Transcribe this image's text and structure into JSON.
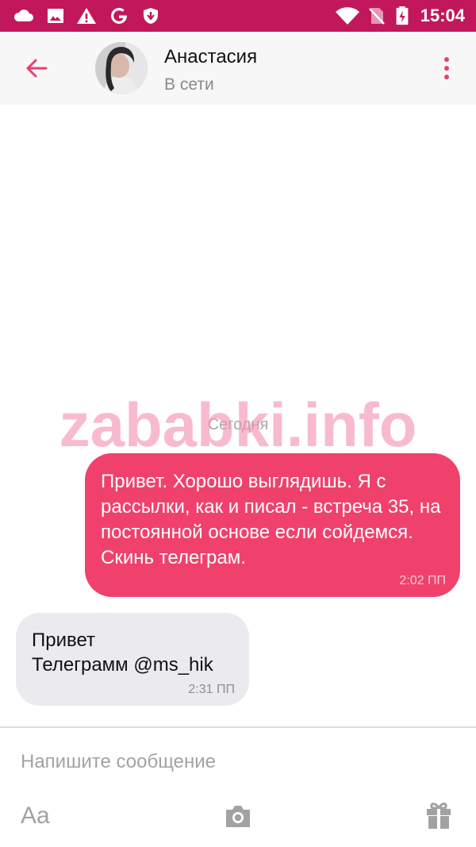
{
  "status_bar": {
    "time": "15:04",
    "icons": [
      "cloud-icon",
      "image-icon",
      "warning-icon",
      "google-icon",
      "shield-icon",
      "wifi-icon",
      "no-sim-icon",
      "battery-charging-icon"
    ]
  },
  "header": {
    "contact_name": "Анастасия",
    "contact_status": "В сети",
    "back_icon": "arrow-left-icon",
    "menu_icon": "more-vertical-icon"
  },
  "chat": {
    "date_separator": "Сегодня",
    "watermark": "zababki.info",
    "messages": [
      {
        "direction": "outgoing",
        "text": "Привет. Хорошо выглядишь. Я с рассылки, как и писал - встреча 35, на постоянной основе если сойдемся. Скинь телеграм.",
        "time": "2:02 ПП"
      },
      {
        "direction": "incoming",
        "text": "Привет\nТелеграмм @ms_hik",
        "time": "2:31 ПП"
      }
    ]
  },
  "composer": {
    "placeholder": "Напишите сообщение",
    "font_button_label": "Aa",
    "camera_icon": "camera-icon",
    "gift_icon": "gift-icon"
  },
  "colors": {
    "status_bar": "#c2185b",
    "accent": "#f0416c",
    "incoming_bubble": "#ebebef",
    "watermark": "#f48fb1"
  }
}
